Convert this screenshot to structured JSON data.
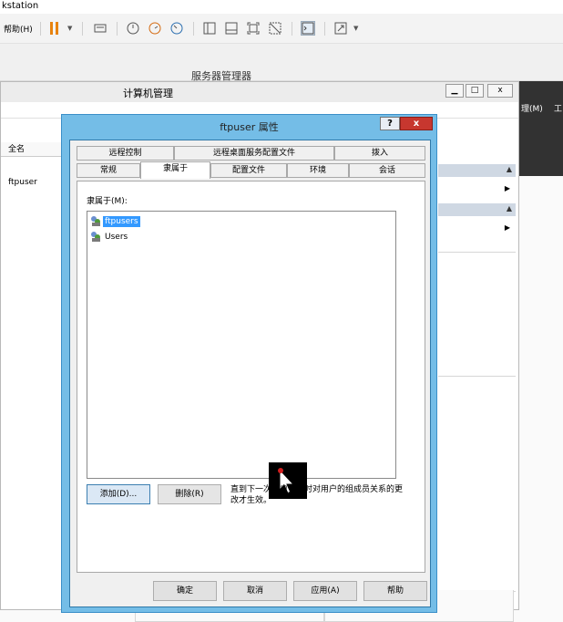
{
  "vmware": {
    "title_fragment": "kstation",
    "help_menu": "帮助(H)"
  },
  "server_manager": {
    "title": "服务器管理器",
    "right_labels": [
      "理(M)",
      "工"
    ]
  },
  "computer_management": {
    "title": "计算机管理",
    "column_header": "全名",
    "row_value": "ftpuser",
    "minimize": "▁",
    "maximize": "□",
    "close": "x"
  },
  "dialog": {
    "title": "ftpuser 属性",
    "help_btn": "?",
    "close_btn": "x",
    "tabs_row1": [
      "远程控制",
      "远程桌面服务配置文件",
      "拨入"
    ],
    "tabs_row2": [
      "常规",
      "隶属于",
      "配置文件",
      "环境",
      "会话"
    ],
    "active_tab": "隶属于",
    "member_of_label": "隶属于(M):",
    "groups": [
      {
        "name": "ftpusers",
        "selected": true
      },
      {
        "name": "Users",
        "selected": false
      }
    ],
    "add_button": "添加(D)...",
    "remove_button": "删除(R)",
    "note": "直到下一次用户登录时对用户的组成员关系的更改才生效。",
    "ok_button": "确定",
    "cancel_button": "取消",
    "apply_button": "应用(A)",
    "help_button": "帮助"
  }
}
